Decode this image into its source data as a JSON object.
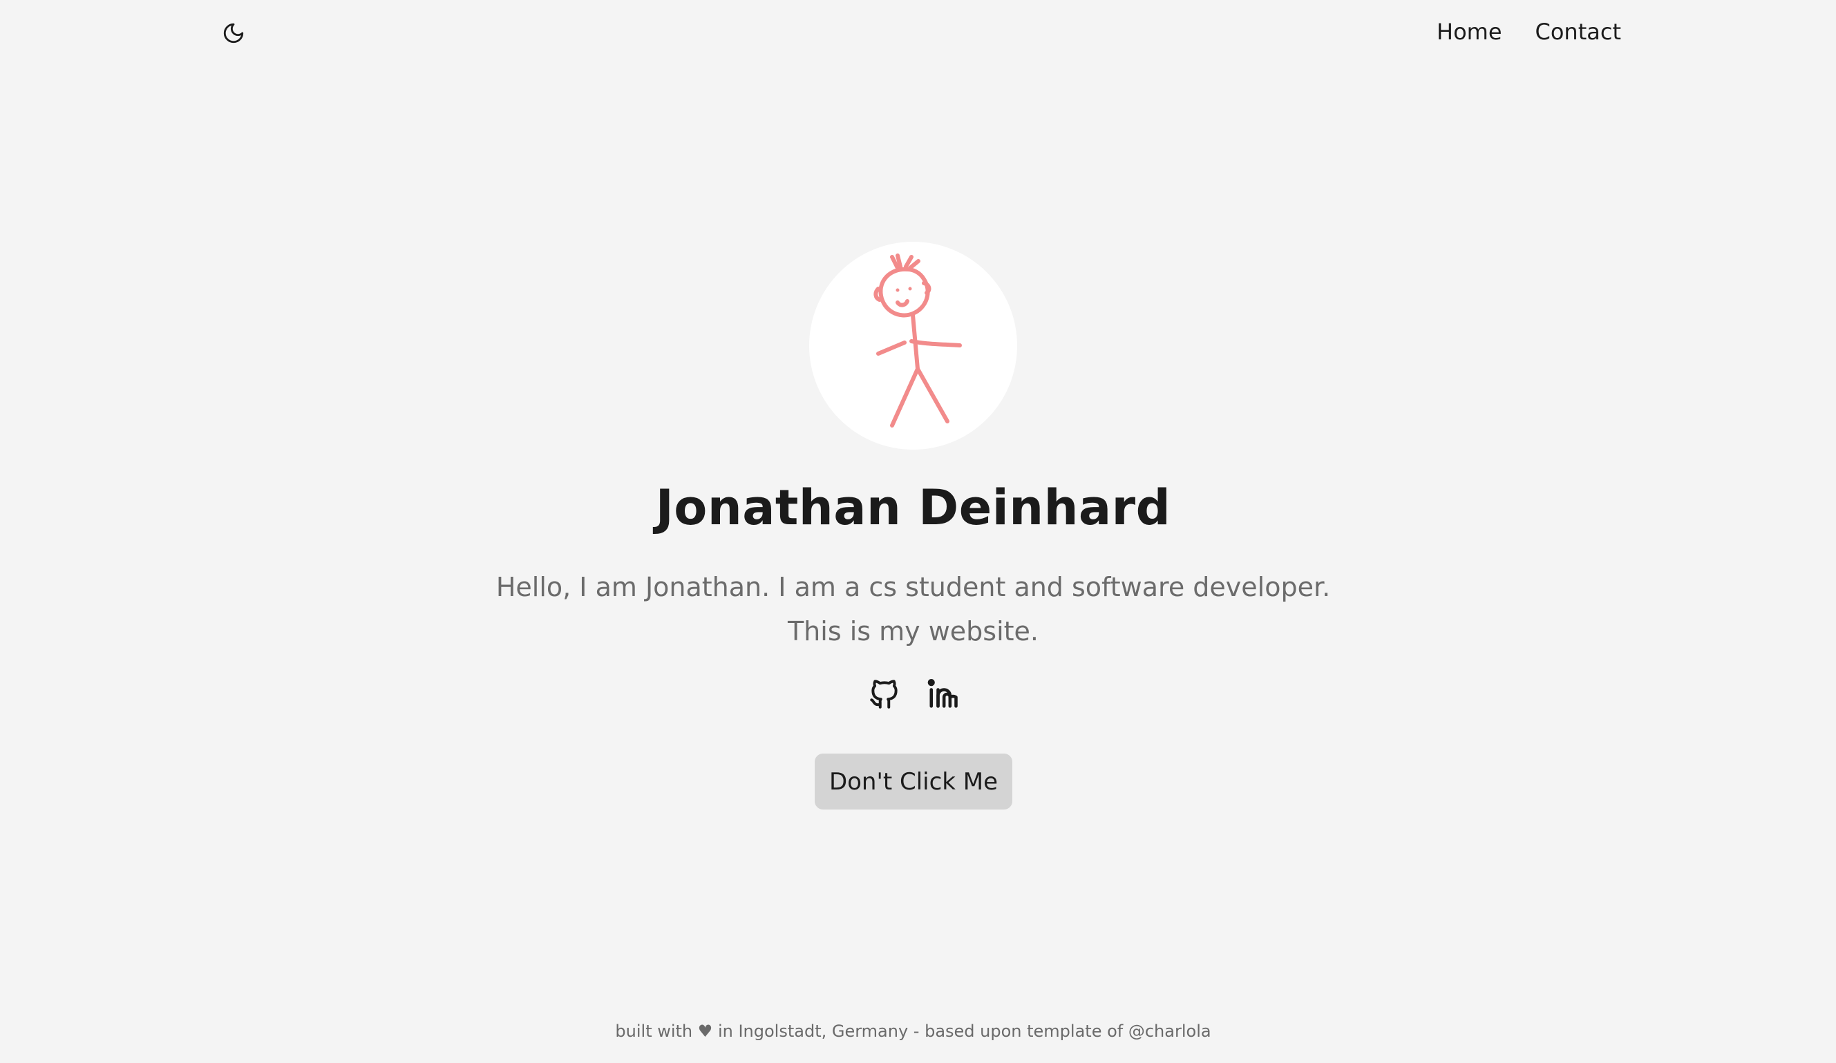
{
  "header": {
    "theme_toggle_icon": "moon-icon",
    "nav": [
      {
        "label": "Home"
      },
      {
        "label": "Contact"
      }
    ]
  },
  "hero": {
    "avatar_icon": "stick-figure-avatar",
    "avatar_color": "#f28b8b",
    "name": "Jonathan Deinhard",
    "bio_line1": "Hello, I am Jonathan. I am a cs student and software developer.",
    "bio_line2": "This is my website.",
    "socials": [
      {
        "icon": "github-icon"
      },
      {
        "icon": "linkedin-icon"
      }
    ],
    "button_label": "Don't Click Me"
  },
  "footer": {
    "text_before": "built with",
    "heart": "♥",
    "text_after": "in Ingolstadt, Germany - based upon template of @charlola"
  },
  "colors": {
    "background": "#f4f4f4",
    "text": "#1b1b1b",
    "muted": "#6b6b6b",
    "button": "#d4d4d4"
  }
}
